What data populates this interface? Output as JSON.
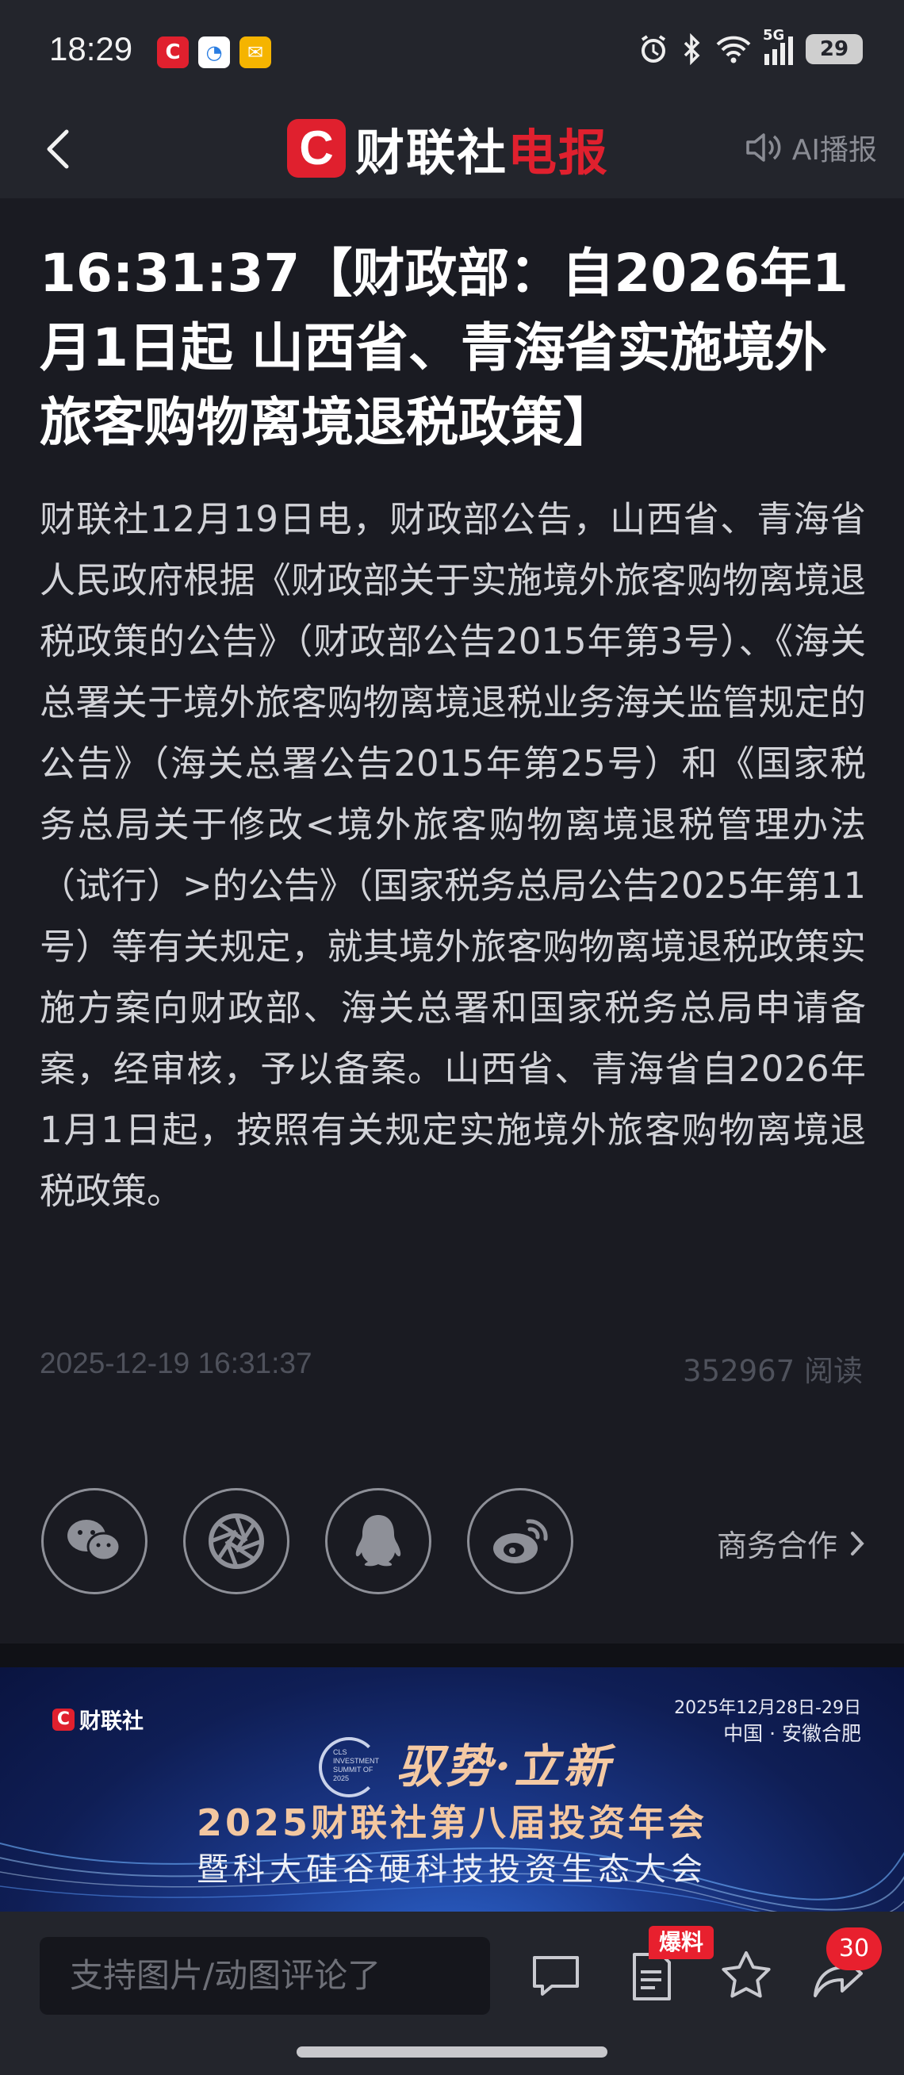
{
  "status_bar": {
    "time": "18:29",
    "battery": "29",
    "network": "5G"
  },
  "nav": {
    "logo_text_white": "财联社",
    "logo_text_red": "电报",
    "ai_label": "AI播报"
  },
  "article": {
    "title": "16:31:37【财政部：自2026年1月1日起 山西省、青海省实施境外旅客购物离境退税政策】",
    "content": "财联社12月19日电，财政部公告，山西省、青海省人民政府根据《财政部关于实施境外旅客购物离境退税政策的公告》（财政部公告2015年第3号）、《海关总署关于境外旅客购物离境退税业务海关监管规定的公告》（海关总署公告2015年第25号）和《国家税务总局关于修改<境外旅客购物离境退税管理办法（试行）>的公告》（国家税务总局公告2025年第11号）等有关规定，就其境外旅客购物离境退税政策实施方案向财政部、海关总署和国家税务总局申请备案，经审核，予以备案。山西省、青海省自2026年1月1日起，按照有关规定实施境外旅客购物离境退税政策。",
    "datetime": "2025-12-19 16:31:37",
    "reads": "352967 阅读",
    "biz_label": "商务合作"
  },
  "banner": {
    "logo": "财联社",
    "date_line1": "2025年12月28日-29日",
    "date_line2": "中国 · 安徽合肥",
    "summit_text": "CLS INVESTMENT SUMMIT OF 2025",
    "slogan": "驭势·立新",
    "main": "2025财联社第八届投资年会",
    "sub": "暨科大硅谷硬科技投资生态大会"
  },
  "bottom_bar": {
    "comment_placeholder": "支持图片/动图评论了",
    "tip_badge": "爆料",
    "share_count": "30"
  },
  "colors": {
    "brand_red": "#e0202e",
    "background": "#1a1b22",
    "bar_background": "#23252c"
  }
}
